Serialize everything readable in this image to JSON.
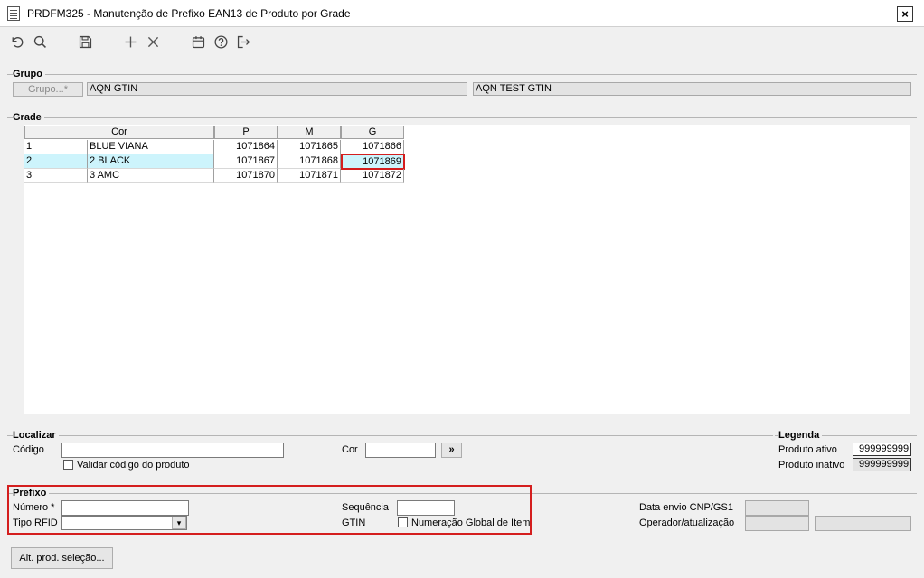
{
  "window": {
    "title": "PRDFM325 - Manutenção de Prefixo EAN13 de Produto por Grade",
    "close": "×"
  },
  "toolbar": {
    "icons": [
      "undo-icon",
      "search-icon",
      "save-icon",
      "add-icon",
      "delete-icon",
      "calendar-icon",
      "help-icon",
      "exit-icon"
    ]
  },
  "grupo": {
    "label": "Grupo",
    "button": "Grupo...*",
    "code": "AQN GTIN",
    "description": "AQN TEST GTIN"
  },
  "grade": {
    "label": "Grade",
    "columns": [
      "Cor",
      "P",
      "M",
      "G"
    ],
    "rows": [
      {
        "num": "1",
        "cor": "BLUE VIANA",
        "p": "1071864",
        "m": "1071865",
        "g": "1071866"
      },
      {
        "num": "2",
        "cor": "2 BLACK",
        "p": "1071867",
        "m": "1071868",
        "g": "1071869"
      },
      {
        "num": "3",
        "cor": "3 AMC",
        "p": "1071870",
        "m": "1071871",
        "g": "1071872"
      }
    ]
  },
  "localizar": {
    "label": "Localizar",
    "codigo_label": "Código",
    "codigo_value": "",
    "cor_label": "Cor",
    "cor_value": "",
    "go_button": "»",
    "validar_label": "Validar código do produto"
  },
  "legenda": {
    "label": "Legenda",
    "ativo_label": "Produto ativo",
    "ativo_value": "999999999",
    "inativo_label": "Produto inativo",
    "inativo_value": "999999999"
  },
  "prefixo": {
    "label": "Prefixo",
    "numero_label": "Número *",
    "numero_value": "",
    "tipo_rfid_label": "Tipo RFID",
    "tipo_rfid_value": "",
    "sequencia_label": "Sequência",
    "sequencia_value": "",
    "gtin_label": "GTIN",
    "numeracao_label": "Numeração Global de Item",
    "data_envio_label": "Data envio CNP/GS1",
    "data_envio_value": "",
    "operador_label": "Operador/atualização",
    "operador_value": "",
    "atualizacao_value": ""
  },
  "footer": {
    "alt_button": "Alt. prod. seleção..."
  },
  "colors": {
    "selected_row": "#cdf4fc",
    "highlight": "#d41e1e"
  }
}
